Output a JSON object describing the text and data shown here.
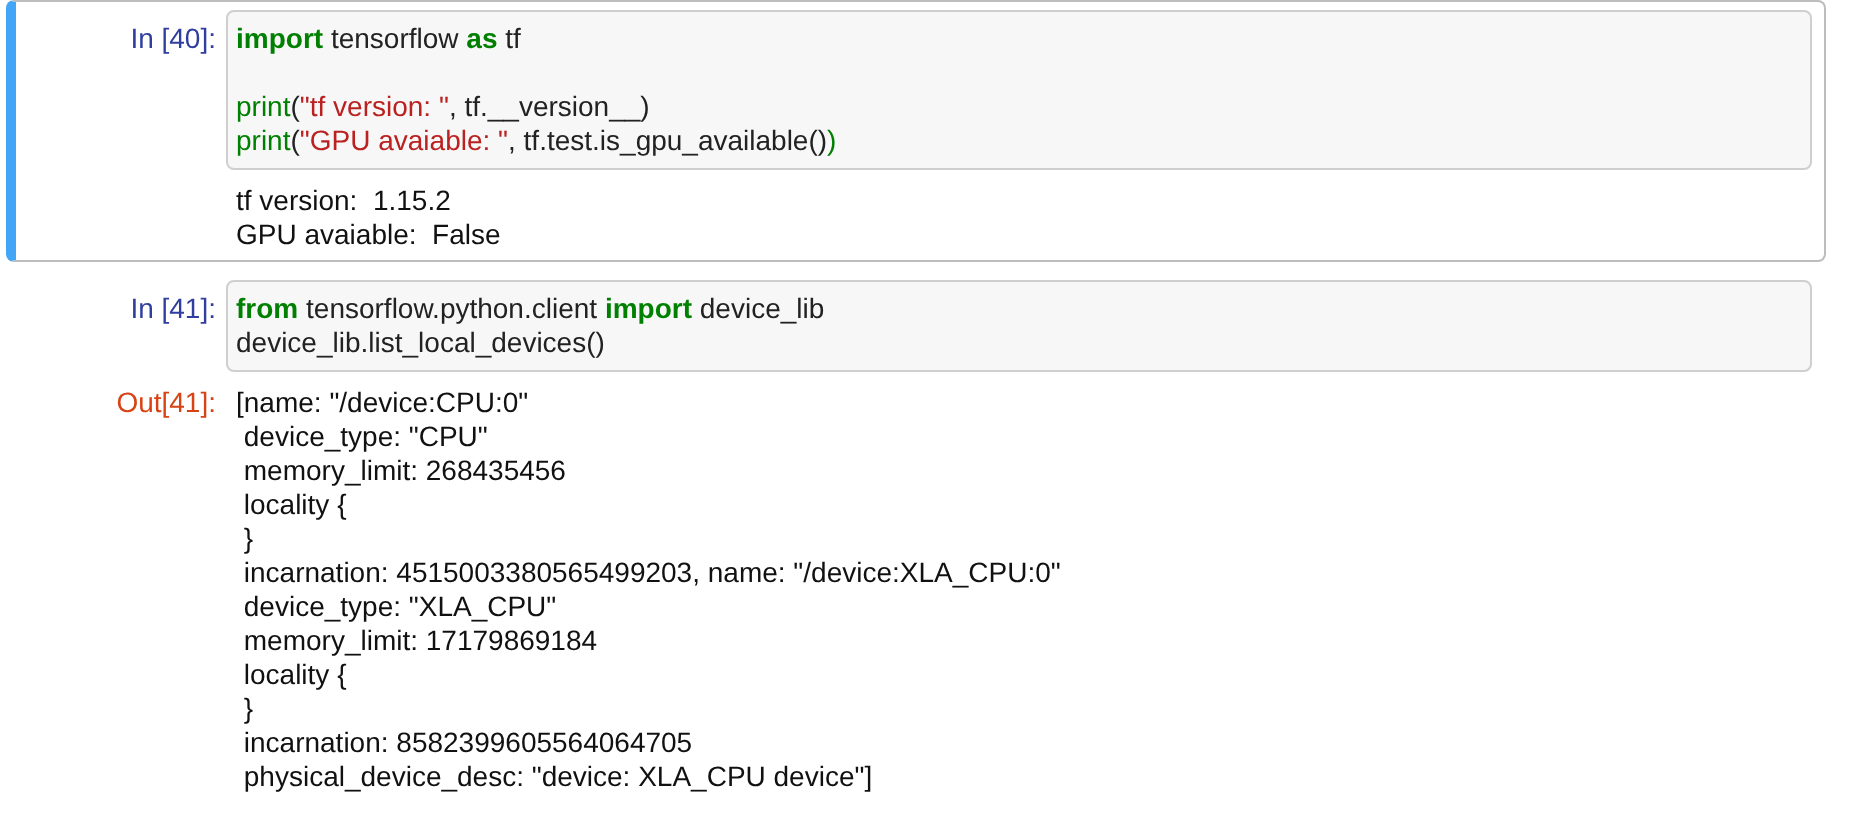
{
  "cells": [
    {
      "selected": true,
      "in_prompt": "In [40]:",
      "code": [
        {
          "kind": "code",
          "tokens": [
            {
              "kind": "keyword",
              "text": "import"
            },
            {
              "kind": "plain",
              "text": " tensorflow "
            },
            {
              "kind": "keyword",
              "text": "as"
            },
            {
              "kind": "plain",
              "text": " tf"
            }
          ]
        },
        {
          "kind": "blank"
        },
        {
          "kind": "code",
          "tokens": [
            {
              "kind": "builtin",
              "text": "print"
            },
            {
              "kind": "plain",
              "text": "("
            },
            {
              "kind": "string",
              "text": "\"tf version: \""
            },
            {
              "kind": "plain",
              "text": ", tf.__version__)"
            }
          ]
        },
        {
          "kind": "code",
          "tokens": [
            {
              "kind": "builtin",
              "text": "print"
            },
            {
              "kind": "plain",
              "text": "("
            },
            {
              "kind": "string",
              "text": "\"GPU avaiable: \""
            },
            {
              "kind": "plain",
              "text": ", tf.test.is_gpu_available()"
            },
            {
              "kind": "builtin",
              "text": ")"
            }
          ]
        }
      ],
      "output": {
        "kind": "stream",
        "lines": [
          "tf version:  1.15.2",
          "GPU avaiable:  False"
        ]
      }
    },
    {
      "selected": false,
      "in_prompt": "In [41]:",
      "code": [
        {
          "kind": "code",
          "tokens": [
            {
              "kind": "keyword",
              "text": "from"
            },
            {
              "kind": "plain",
              "text": " tensorflow.python.client "
            },
            {
              "kind": "keyword",
              "text": "import"
            },
            {
              "kind": "plain",
              "text": " device_lib"
            }
          ]
        },
        {
          "kind": "code",
          "tokens": [
            {
              "kind": "plain",
              "text": "device_lib.list_local_devices()"
            }
          ]
        }
      ],
      "output": {
        "kind": "result",
        "prompt": "Out[41]:",
        "lines": [
          "[name: \"/device:CPU:0\"",
          " device_type: \"CPU\"",
          " memory_limit: 268435456",
          " locality {",
          " }",
          " incarnation: 4515003380565499203, name: \"/device:XLA_CPU:0\"",
          " device_type: \"XLA_CPU\"",
          " memory_limit: 17179869184",
          " locality {",
          " }",
          " incarnation: 8582399605564064705",
          " physical_device_desc: \"device: XLA_CPU device\"]"
        ]
      }
    }
  ]
}
